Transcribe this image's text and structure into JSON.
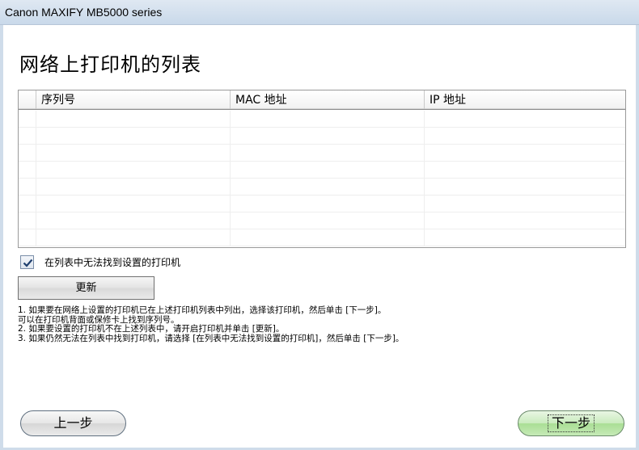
{
  "window": {
    "title": "Canon MAXIFY MB5000 series"
  },
  "page": {
    "heading": "网络上打印机的列表"
  },
  "printer_table": {
    "columns": [
      "",
      "序列号",
      "MAC 地址",
      "IP 地址"
    ],
    "rows": []
  },
  "options": {
    "not_found_checkbox_label": "在列表中无法找到设置的打印机",
    "not_found_checked": true
  },
  "buttons": {
    "refresh_label": "更新",
    "back_label": "上一步",
    "next_label": "下一步"
  },
  "instructions": [
    "1.  如果要在网络上设置的打印机已在上述打印机列表中列出，选择该打印机，然后单击 [下一步]。",
    "可以在打印机背面或保修卡上找到序列号。",
    "2.  如果要设置的打印机不在上述列表中，请开启打印机并单击 [更新]。",
    "3.  如果仍然无法在列表中找到打印机，请选择 [在列表中无法找到设置的打印机]，然后单击 [下一步]。"
  ],
  "icons": {
    "checkmark": "check-icon"
  },
  "colors": {
    "next_button": "#b7e3a5",
    "title_bar": "#d6e2ef",
    "checkmark": "#1f3f6e"
  }
}
